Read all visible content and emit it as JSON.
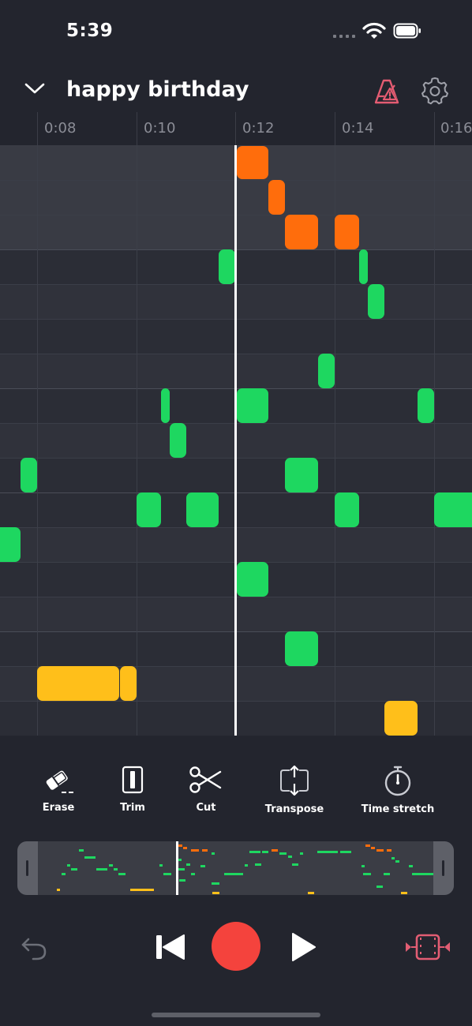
{
  "status_bar": {
    "time": "5:39"
  },
  "header": {
    "title": "happy birthday"
  },
  "timeline": {
    "ticks": [
      "0:08",
      "0:10",
      "0:12",
      "0:14",
      "0:16"
    ]
  },
  "tools": {
    "erase": "Erase",
    "trim": "Trim",
    "cut": "Cut",
    "transpose": "Transpose",
    "time_stretch": "Time stretch"
  },
  "colors": {
    "melody": "#1ed760",
    "highlight": "#ff6d0c",
    "bass": "#ffbf1a",
    "record": "#f4433d",
    "warning": "#e45c72",
    "fit": "#e25d73"
  },
  "icons": {
    "collapse": "chevron-down-icon",
    "metronome": "metronome-warning-icon",
    "settings": "gear-icon",
    "erase": "eraser-icon",
    "trim": "trim-icon",
    "cut": "scissors-icon",
    "transpose": "transpose-icon",
    "time_stretch": "stopwatch-icon",
    "undo": "undo-icon",
    "skip_back": "skip-back-icon",
    "record": "record-icon",
    "play": "play-icon",
    "fit": "fit-to-screen-icon"
  }
}
